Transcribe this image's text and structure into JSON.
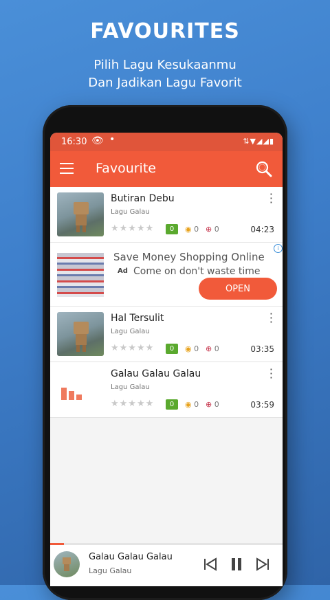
{
  "promo": {
    "title": "FAVOURITES",
    "subtitle_line1": "Pilih Lagu Kesukaanmu",
    "subtitle_line2": "Dan Jadikan Lagu Favorit"
  },
  "statusbar": {
    "time": "16:30",
    "eye_icon": "eye-icon",
    "dot": "•",
    "icons_text": "⇅▼◢◢▮"
  },
  "appbar": {
    "title": "Favourite",
    "menu_icon": "hamburger-menu-icon",
    "search_icon": "search-icon"
  },
  "songs": [
    {
      "name": "Butiran Debu",
      "artist": "Lagu Galau",
      "stars": "★★★★★",
      "rating": "0",
      "views": "0",
      "downloads": "0",
      "duration": "04:23"
    },
    {
      "name": "Hal Tersulit",
      "artist": "Lagu Galau",
      "stars": "★★★★★",
      "rating": "0",
      "views": "0",
      "downloads": "0",
      "duration": "03:35"
    },
    {
      "name": "Galau Galau Galau",
      "artist": "Lagu Galau",
      "stars": "★★★★★",
      "rating": "0",
      "views": "0",
      "downloads": "0",
      "duration": "03:59"
    }
  ],
  "ad": {
    "title": "Save Money Shopping Online",
    "label": "Ad",
    "description": "Come on don't waste time",
    "button": "OPEN",
    "info_icon": "i"
  },
  "player": {
    "song": "Galau Galau Galau",
    "artist": "Lagu Galau",
    "progress_percent": 6
  },
  "colors": {
    "accent": "#f15a3a",
    "statusbar": "#e0553a",
    "background": "#3e7fcb",
    "badge": "#5aa92e"
  }
}
